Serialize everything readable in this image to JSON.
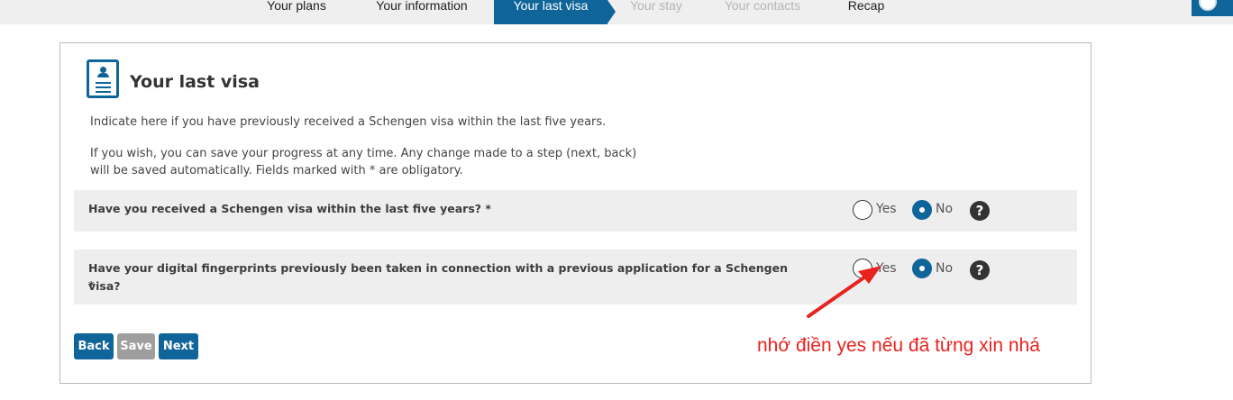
{
  "steps": [
    {
      "label": "Your plans",
      "state": "done"
    },
    {
      "label": "Your information",
      "state": "done"
    },
    {
      "label": "Your last visa",
      "state": "active"
    },
    {
      "label": "Your stay",
      "state": "disabled"
    },
    {
      "label": "Your contacts",
      "state": "disabled"
    },
    {
      "label": "Recap",
      "state": "done"
    }
  ],
  "panel": {
    "icon": "visa-document-icon",
    "title": "Your last visa",
    "intro": "Indicate here if you have previously received a Schengen visa within the last five years.",
    "info_line1": "If you wish, you can save your progress at any time. Any change made to a step (next, back)",
    "info_line2": "will be saved automatically. Fields marked with * are obligatory."
  },
  "questions": [
    {
      "text": "Have you received a Schengen visa within the last five years? *",
      "options": [
        "Yes",
        "No"
      ],
      "selected": "No",
      "help_icon": "question-mark-icon",
      "help_label": "?"
    },
    {
      "text": "Have your digital fingerprints previously been taken in connection with a previous application for a Schengen visa?",
      "text_line2": "*",
      "options": [
        "Yes",
        "No"
      ],
      "selected": "No",
      "help_icon": "question-mark-icon",
      "help_label": "?"
    }
  ],
  "buttons": {
    "back": "Back",
    "save": "Save",
    "next": "Next"
  },
  "annotation": {
    "text": "nhớ điền yes nếu đã từng xin nhá",
    "color": "#e8231d"
  },
  "colors": {
    "accent": "#0f659a",
    "step_bar_bg": "#efefef",
    "row_bg": "#eeeeee",
    "disabled_text": "#b5b5b5"
  }
}
